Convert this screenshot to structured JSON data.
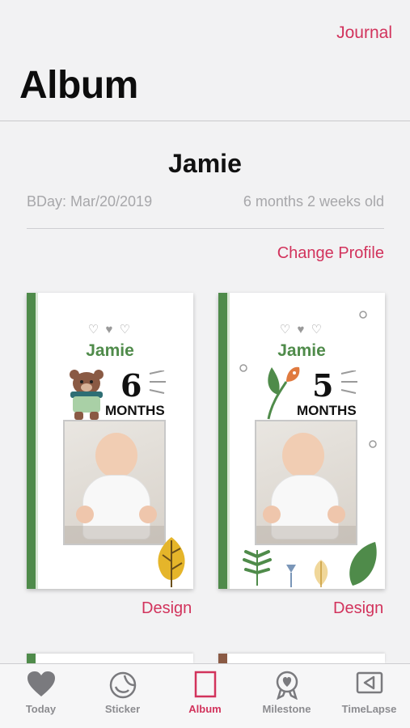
{
  "header": {
    "journal_label": "Journal",
    "title": "Album"
  },
  "profile": {
    "name": "Jamie",
    "bday": "BDay: Mar/20/2019",
    "age": "6 months 2 weeks old",
    "change_profile_label": "Change Profile"
  },
  "albums": [
    {
      "name": "Jamie",
      "month_number": "6",
      "month_word": "MONTHS",
      "design_label": "Design",
      "spine_color": "#4f8b4a"
    },
    {
      "name": "Jamie",
      "month_number": "5",
      "month_word": "MONTHS",
      "design_label": "Design",
      "spine_color": "#4f8b4a"
    }
  ],
  "tabs": [
    {
      "label": "Today",
      "icon": "heart-icon",
      "active": false
    },
    {
      "label": "Sticker",
      "icon": "sticker-icon",
      "active": false
    },
    {
      "label": "Album",
      "icon": "album-icon",
      "active": true
    },
    {
      "label": "Milestone",
      "icon": "milestone-icon",
      "active": false
    },
    {
      "label": "TimeLapse",
      "icon": "timelapse-icon",
      "active": false
    }
  ],
  "colors": {
    "accent": "#d2335c",
    "cover_green": "#4f8b4a",
    "tab_inactive": "#8c8c90"
  }
}
